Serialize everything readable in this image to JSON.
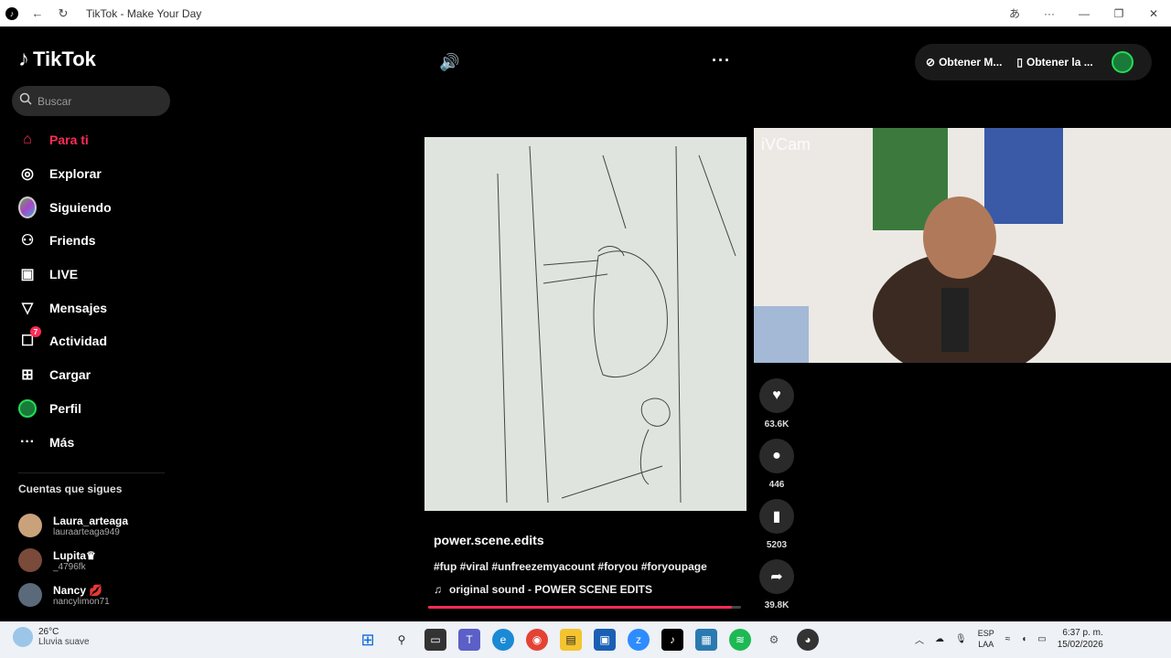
{
  "titlebar": {
    "title": "TikTok - Make Your Day",
    "icons": [
      "tiktok-logo-icon",
      "back-arrow-icon",
      "refresh-icon",
      "translate-icon",
      "more-icon",
      "minimize-icon",
      "restore-icon",
      "close-icon"
    ]
  },
  "sidebar": {
    "logo_text": "TikTok",
    "search_placeholder": "Buscar",
    "nav": [
      {
        "label": "Para ti",
        "icon": "home-icon",
        "active": true
      },
      {
        "label": "Explorar",
        "icon": "compass-icon"
      },
      {
        "label": "Siguiendo",
        "icon": "following-icon"
      },
      {
        "label": "Friends",
        "icon": "friends-icon"
      },
      {
        "label": "LIVE",
        "icon": "live-icon"
      },
      {
        "label": "Mensajes",
        "icon": "messages-icon"
      },
      {
        "label": "Actividad",
        "icon": "activity-icon",
        "badge": "7"
      },
      {
        "label": "Cargar",
        "icon": "upload-icon"
      },
      {
        "label": "Perfil",
        "icon": "profile-icon"
      },
      {
        "label": "Más",
        "icon": "more-icon"
      }
    ],
    "follows_title": "Cuentas que sigues",
    "follows": [
      {
        "name": "Laura_arteaga",
        "user": "lauraarteaga949"
      },
      {
        "name": "Lupita♛",
        "user": "_4796fk"
      },
      {
        "name": "Nancy 💋",
        "user": "nancylimon71"
      }
    ]
  },
  "topbar": {
    "get_app_1": "Obtener M...",
    "get_app_2": "Obtener la ..."
  },
  "camera": {
    "label": "iVCam"
  },
  "video": {
    "username": "power.scene.edits",
    "hashtags": "#fup #viral #unfreezemyacount #foryou #foryoupage",
    "sound": "original sound - POWER SCENE EDITS",
    "progress": 0.97
  },
  "actions": {
    "likes": "63.6K",
    "comments": "446",
    "saves": "5203",
    "shares": "39.8K"
  },
  "taskbar": {
    "temp": "26°C",
    "weather": "Lluvia suave",
    "lang_1": "ESP",
    "lang_2": "LAA",
    "time": "6:37 p. m.",
    "date": "15/02/2026"
  }
}
